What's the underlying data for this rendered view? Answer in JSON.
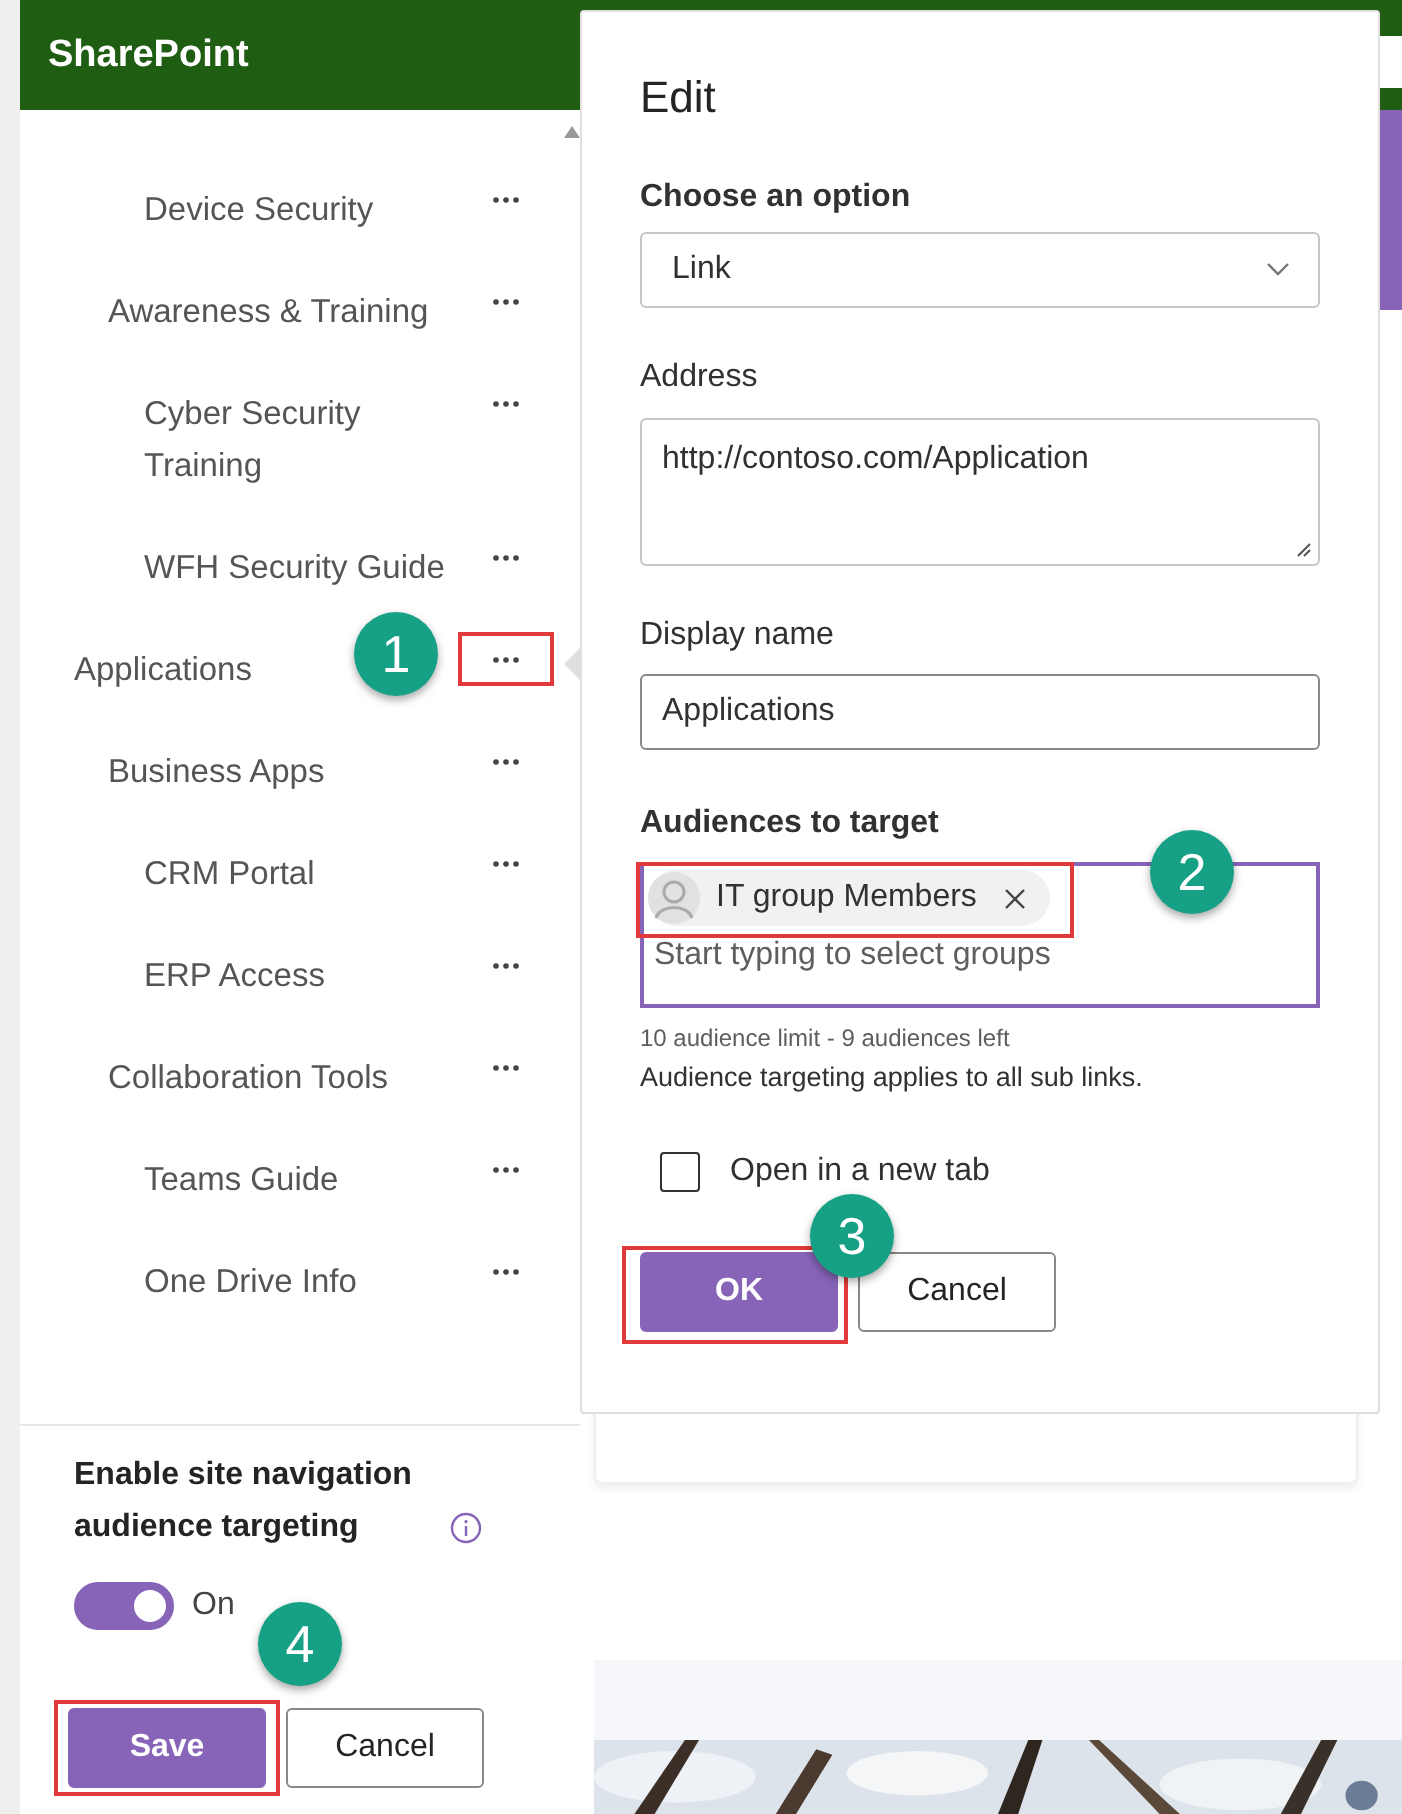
{
  "header": {
    "title": "SharePoint"
  },
  "nav": {
    "items": [
      {
        "children": [
          {
            "children": [
              {
                "label": "Device Security"
              }
            ]
          },
          {
            "label": "Awareness & Training",
            "children": [
              {
                "label": "Cyber Security Training"
              },
              {
                "label": "WFH Security Guide"
              }
            ]
          }
        ]
      },
      {
        "label": "Applications",
        "children": [
          {
            "label": "Business Apps",
            "children": [
              {
                "label": "CRM Portal"
              },
              {
                "label": "ERP Access"
              }
            ]
          },
          {
            "label": "Collaboration Tools",
            "children": [
              {
                "label": "Teams Guide"
              },
              {
                "label": "One Drive Info"
              }
            ]
          }
        ]
      }
    ]
  },
  "targeting": {
    "label": "Enable site navigation audience targeting",
    "toggle": {
      "on": true,
      "label": "On"
    }
  },
  "buttons": [
    {
      "label": "Save",
      "primary": true
    },
    {
      "label": "Cancel",
      "primary": false
    }
  ],
  "dialog": {
    "title": "Edit",
    "option_label": "Choose an option",
    "option_value": "Link",
    "address_label": "Address",
    "address_value": "http://contoso.com/Application",
    "display_name_label": "Display name",
    "display_name_value": "Applications",
    "audiences_label": "Audiences to target",
    "audiences": [
      {
        "name": "IT group Members"
      }
    ],
    "audience_placeholder": "Start typing to select groups",
    "limit_note": "10 audience limit - 9 audiences left",
    "note": "Audience targeting applies to all sub links.",
    "new_tab": {
      "label": "Open in a new tab",
      "checked": false
    },
    "buttons": [
      {
        "label": "OK",
        "primary": true
      },
      {
        "label": "Cancel",
        "primary": false
      }
    ]
  },
  "callouts": [
    {
      "label": "1"
    },
    {
      "label": "2"
    },
    {
      "label": "3"
    },
    {
      "label": "4"
    }
  ]
}
